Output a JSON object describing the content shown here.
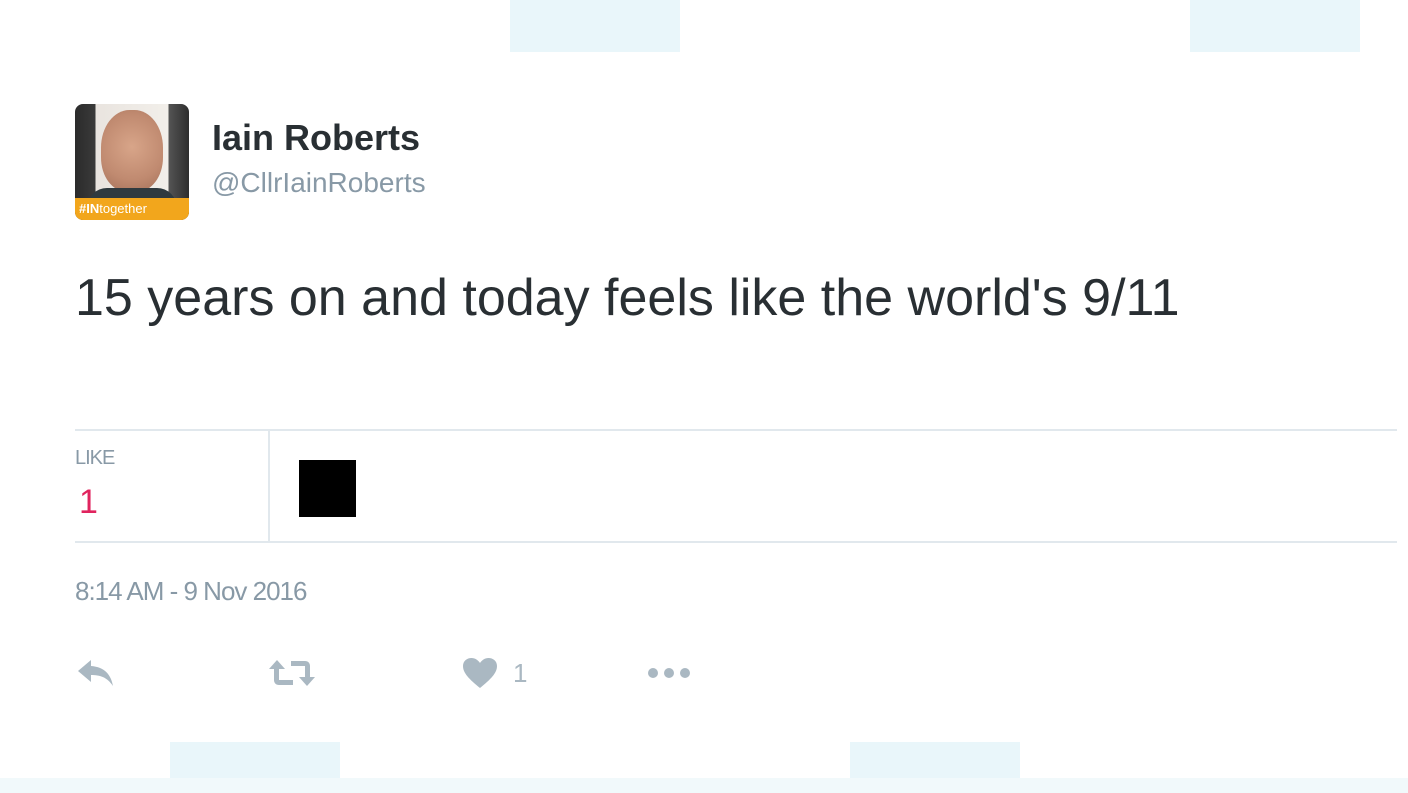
{
  "user": {
    "display_name": "Iain Roberts",
    "handle": "@CllrIainRoberts",
    "avatar_badge": {
      "bold": "#IN",
      "rest": "together"
    }
  },
  "tweet": {
    "text": "15 years on and today feels like the world's 9/11"
  },
  "stats": {
    "like_label": "LIKE",
    "like_count": "1"
  },
  "timestamp": "8:14 AM - 9 Nov 2016",
  "actions": {
    "reply_icon": "reply-icon",
    "retweet_icon": "retweet-icon",
    "like_icon": "heart-icon",
    "like_count": "1",
    "more_icon": "more-dots-icon"
  },
  "colors": {
    "text": "#292f33",
    "muted": "#8899a6",
    "icon": "#aab8c2",
    "like": "#e0245e",
    "border": "#e1e8ed",
    "badge": "#f2a61c"
  }
}
